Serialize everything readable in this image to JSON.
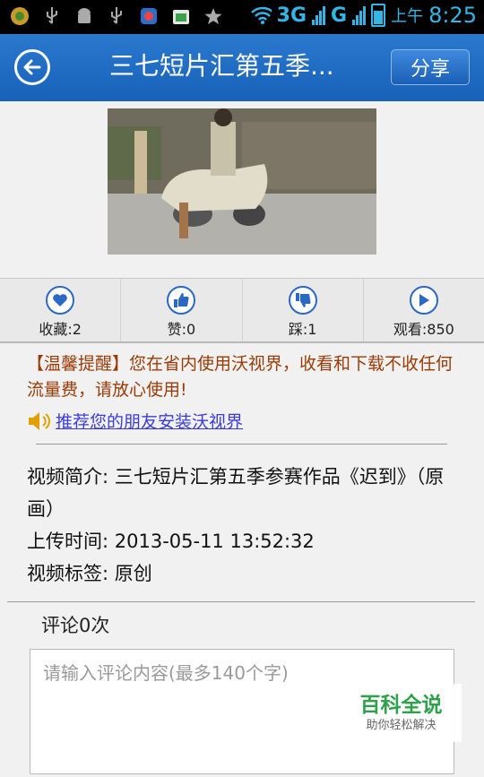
{
  "status_bar": {
    "network_3g": "3G",
    "network_g": "G",
    "signal_sub": "2",
    "ampm": "上午",
    "time": "8:25"
  },
  "header": {
    "title": "三七短片汇第五季...",
    "share_label": "分享"
  },
  "actions": [
    {
      "icon": "heart-icon",
      "label": "收藏:2"
    },
    {
      "icon": "thumbs-up-icon",
      "label": "赞:0"
    },
    {
      "icon": "thumbs-down-icon",
      "label": "踩:1"
    },
    {
      "icon": "play-icon",
      "label": "观看:850"
    }
  ],
  "notice": "【温馨提醒】您在省内使用沃视界，收看和下载不收任何流量费，请放心使用!",
  "promo_link": "推荐您的朋友安装沃视界",
  "info": {
    "intro": "视频简介:  三七短片汇第五季参赛作品《迟到》（原画）",
    "upload_time": "上传时间: 2013-05-11 13:52:32",
    "tags": "视频标签:  原创"
  },
  "comments": {
    "count_label": "评论0次",
    "placeholder": "请输入评论内容(最多140个字)"
  },
  "watermark": {
    "title": "百科全说",
    "subtitle": "助你轻松解决"
  },
  "colors": {
    "title_bar": "#1f6cc4",
    "accent_icon": "#2a68c4",
    "notice_text": "#9b3b06",
    "status_icons": "#33b5e5"
  }
}
